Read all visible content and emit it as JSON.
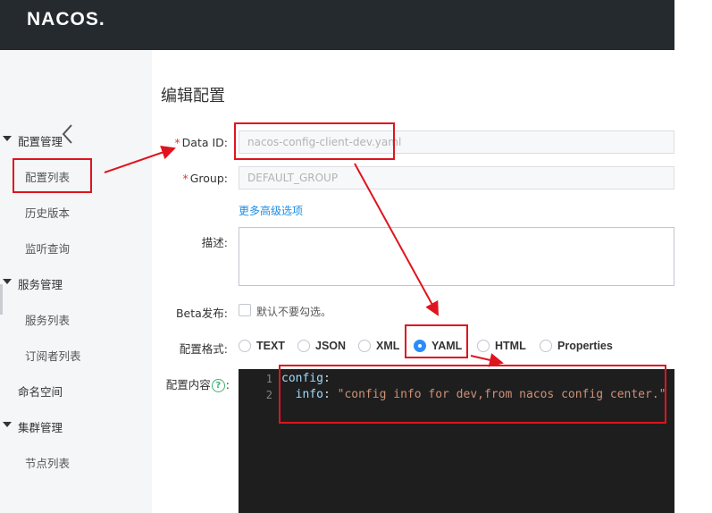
{
  "header": {
    "logo": "NACOS",
    "logo_dot": "."
  },
  "sidebar": {
    "groups": [
      {
        "label": "配置管理",
        "items": [
          "配置列表",
          "历史版本",
          "监听查询"
        ]
      },
      {
        "label": "服务管理",
        "items": [
          "服务列表",
          "订阅者列表"
        ]
      },
      {
        "label": "命名空间",
        "items": []
      },
      {
        "label": "集群管理",
        "items": [
          "节点列表"
        ]
      }
    ]
  },
  "form": {
    "title": "编辑配置",
    "data_id": {
      "label": "Data ID:",
      "value": "nacos-config-client-dev.yaml"
    },
    "group": {
      "label": "Group:",
      "value": "DEFAULT_GROUP"
    },
    "more_options": "更多高级选项",
    "description": {
      "label": "描述:"
    },
    "beta": {
      "label": "Beta发布:",
      "checkbox_text": "默认不要勾选。"
    },
    "format": {
      "label": "配置格式:",
      "options": [
        "TEXT",
        "JSON",
        "XML",
        "YAML",
        "HTML",
        "Properties"
      ],
      "selected": "YAML"
    },
    "content": {
      "label": "配置内容",
      "label_suffix": ":",
      "help_icon": "?",
      "line_numbers": [
        "1",
        "2"
      ],
      "line1_key": "config",
      "line1_colon": ":",
      "line2_indent": "  ",
      "line2_key": "info",
      "line2_colon": ": ",
      "line2_value": "\"config info for dev,from nacos config center.\""
    }
  },
  "annotations": {
    "color": "#e0141e"
  }
}
